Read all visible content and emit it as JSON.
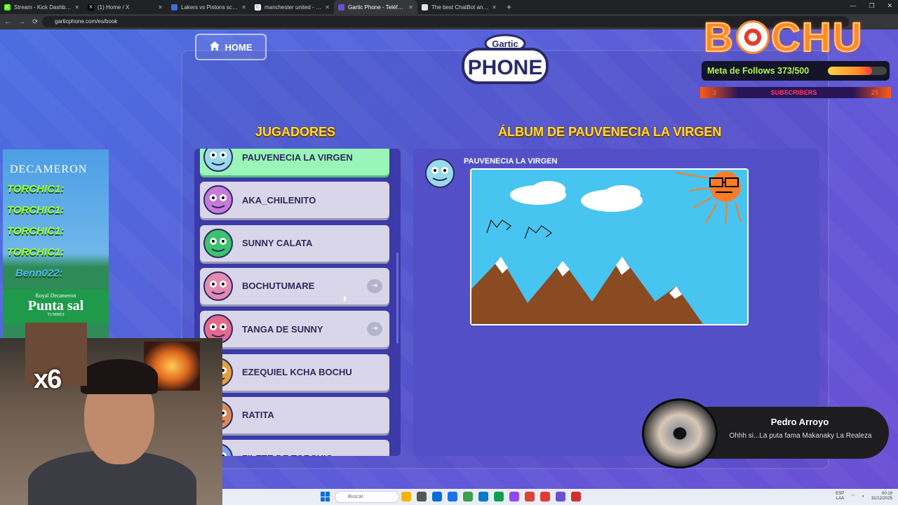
{
  "browser": {
    "tabs": [
      {
        "label": "Stream - Kick Dashboard",
        "icon": "kick-icon",
        "color": "#53fc18",
        "glyph": "K"
      },
      {
        "label": "(1) Home / X",
        "icon": "x-icon",
        "color": "#000000",
        "glyph": "X"
      },
      {
        "label": "Lakers vs Pistons scores & pred",
        "icon": "sports-icon",
        "color": "#3b6fd6",
        "glyph": ""
      },
      {
        "label": "manchester united - Buscar co",
        "icon": "google-icon",
        "color": "#ffffff",
        "glyph": "G"
      },
      {
        "label": "Gartic Phone - Teléfono De",
        "icon": "gartic-icon",
        "color": "#6a4fd4",
        "glyph": ""
      },
      {
        "label": "The best ChatBot and Widg",
        "icon": "chatbot-icon",
        "color": "#e0e0e0",
        "glyph": ""
      }
    ],
    "active_tab": 4,
    "url": "garticphone.com/es/book"
  },
  "game": {
    "home_label": "HOME",
    "logo_small": "Gartic",
    "logo_big": "PHONE",
    "players_title": "JUGADORES",
    "album_title": "ÁLBUM DE PAUVENECIA LA VIRGEN",
    "players": [
      {
        "name": "PAUVENECIA LA VIRGEN",
        "active": true,
        "color": "#9ad9e8",
        "kick": false
      },
      {
        "name": "AKA_CHILENITO",
        "active": false,
        "color": "#c77bd8",
        "kick": false
      },
      {
        "name": "SUNNY CALATA",
        "active": false,
        "color": "#3cc46a",
        "kick": false
      },
      {
        "name": "BOCHUTUMARE",
        "active": false,
        "color": "#e58ab0",
        "kick": true
      },
      {
        "name": "TANGA DE SUNNY",
        "active": false,
        "color": "#e56a8a",
        "kick": true
      },
      {
        "name": "EZEQUIEL KCHA BOCHU",
        "active": false,
        "color": "#e5a03a",
        "kick": false
      },
      {
        "name": "RATITA",
        "active": false,
        "color": "#d98a5a",
        "kick": false
      },
      {
        "name": "FILETE DE TORCHIC",
        "active": false,
        "color": "#7aa0e5",
        "kick": false
      }
    ],
    "album_author": "PAUVENECIA LA VIRGEN"
  },
  "overlay": {
    "brand": "BOCHU",
    "follows_label": "Meta de Follows 373/500",
    "follows_progress": 0.746,
    "subs_count_left": "3",
    "subs_label": "SUBSCRIBERS",
    "subs_count_right": "25",
    "ad_title": "DECAMERON",
    "ad_resort": "Royal Decameron",
    "ad_place": "Punta sal",
    "ad_region": "TUMBES",
    "chat_lines": [
      "TORCHIC1:",
      "TORCHIC1:",
      "TORCHIC1:",
      "TORCHIC1:",
      "Benn022:"
    ],
    "multiplier": "x6",
    "chat_popup": {
      "name": "Pedro Arroyo",
      "message": "Ohhh si...La puta fama Makanaky La Realeza"
    }
  },
  "taskbar": {
    "search_placeholder": "Buscar",
    "lang_line1": "ESP",
    "lang_line2": "LAA",
    "time": "00:19",
    "date": "31/12/2025"
  }
}
